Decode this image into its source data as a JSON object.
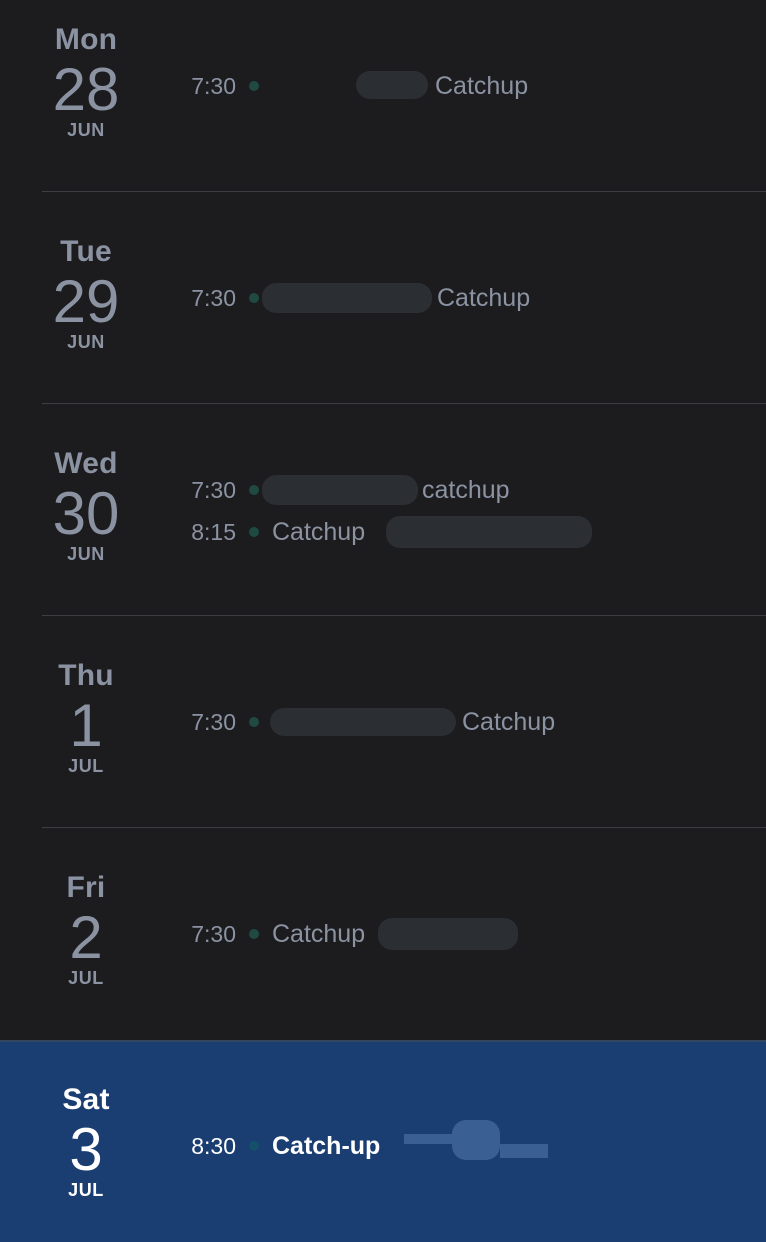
{
  "days": [
    {
      "weekday": "Mon",
      "day": "28",
      "month": "JUN",
      "events": [
        {
          "time": "7:30",
          "title": "Catchup"
        }
      ]
    },
    {
      "weekday": "Tue",
      "day": "29",
      "month": "JUN",
      "events": [
        {
          "time": "7:30",
          "title": "Catchup"
        }
      ]
    },
    {
      "weekday": "Wed",
      "day": "30",
      "month": "JUN",
      "events": [
        {
          "time": "7:30",
          "title": "catchup"
        },
        {
          "time": "8:15",
          "title": "Catchup"
        }
      ]
    },
    {
      "weekday": "Thu",
      "day": "1",
      "month": "JUL",
      "events": [
        {
          "time": "7:30",
          "title": "Catchup"
        }
      ]
    },
    {
      "weekday": "Fri",
      "day": "2",
      "month": "JUL",
      "events": [
        {
          "time": "7:30",
          "title": "Catchup"
        }
      ]
    },
    {
      "weekday": "Sat",
      "day": "3",
      "month": "JUL",
      "selected": true,
      "events": [
        {
          "time": "8:30",
          "title": "Catch-up"
        }
      ]
    }
  ],
  "colors": {
    "background": "#1c1c1e",
    "selected_background": "#1a3d72",
    "muted_text": "#8b93a3",
    "event_dot": "#1f4a42",
    "separator": "#3e3e42"
  }
}
